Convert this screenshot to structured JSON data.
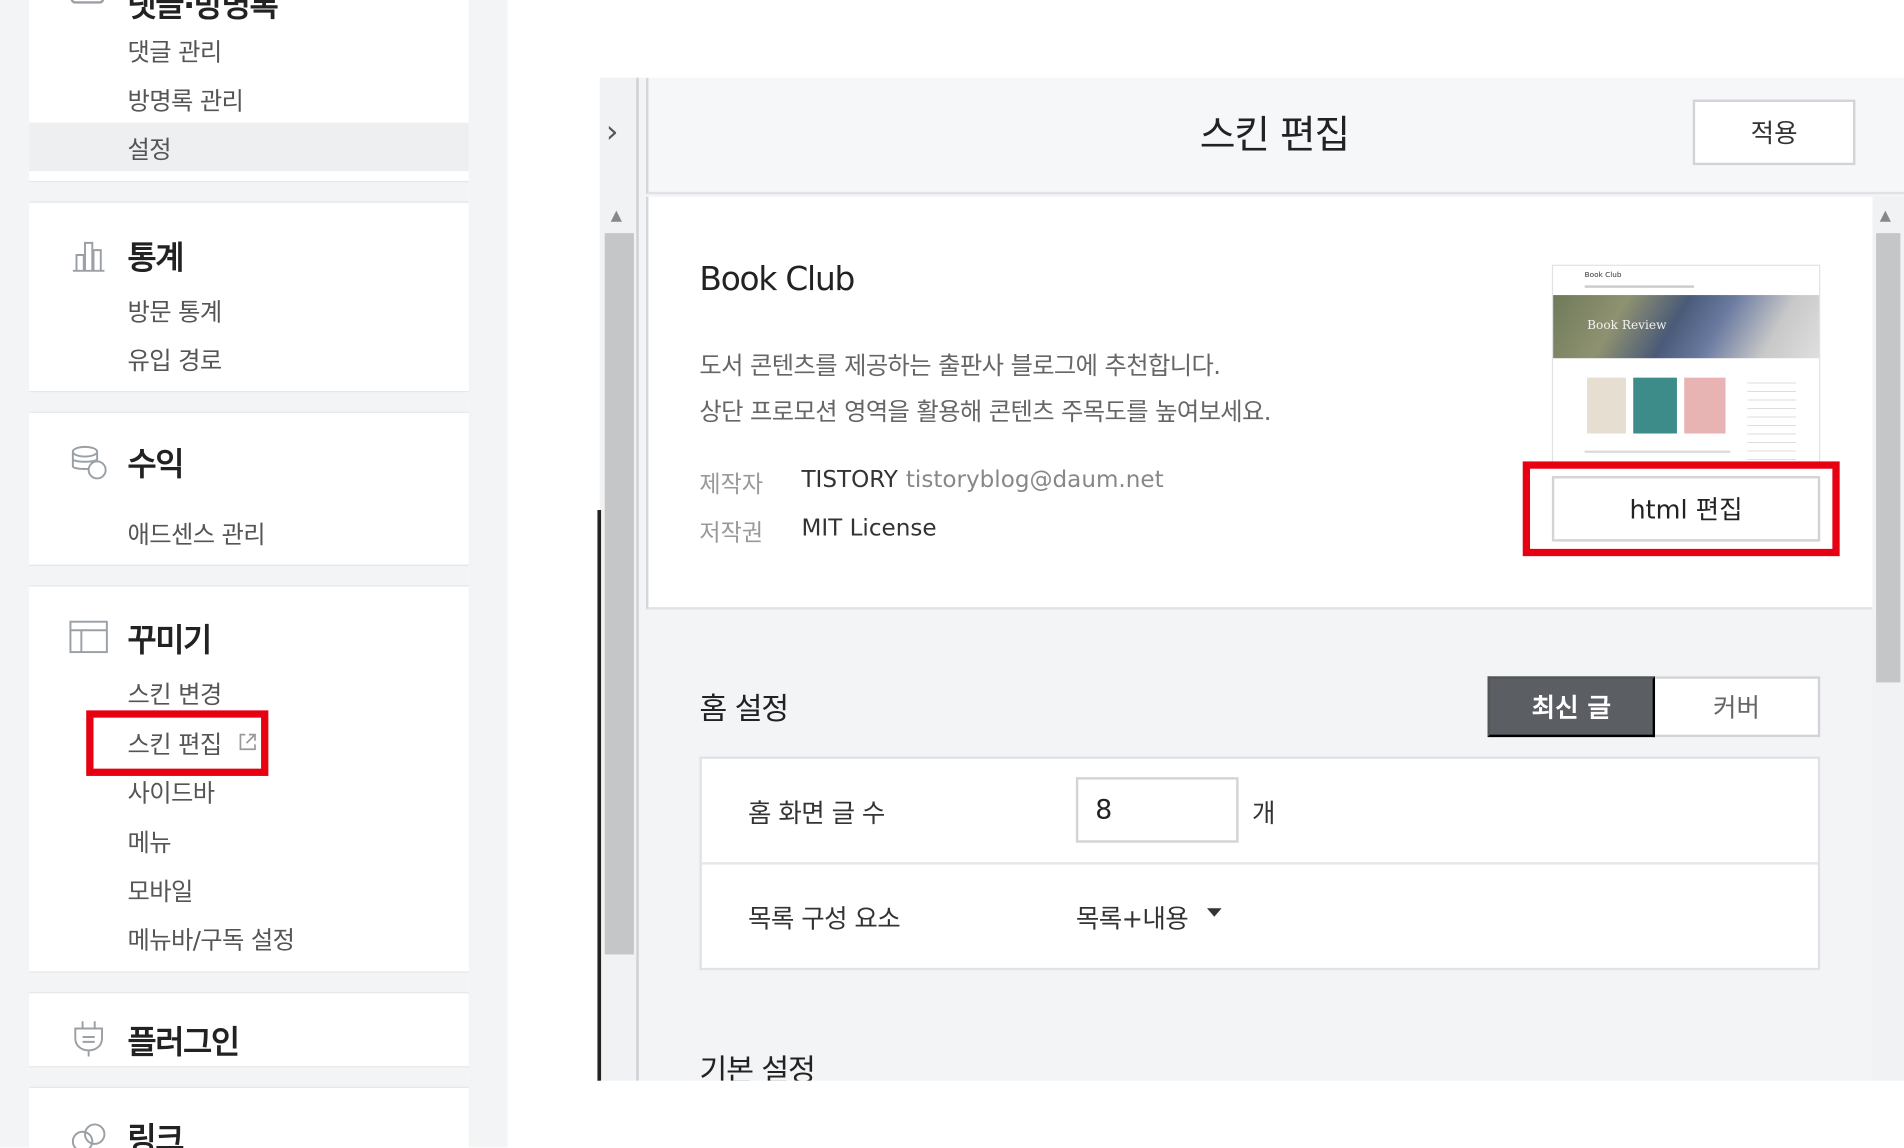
{
  "sidebar": {
    "top_partial_title": "댓글·방명록",
    "comments_items": [
      "댓글 관리",
      "방명록 관리",
      "설정"
    ],
    "stats": {
      "title": "통계",
      "items": [
        "방문 통계",
        "유입 경로"
      ]
    },
    "revenue": {
      "title": "수익",
      "items": [
        "애드센스 관리"
      ]
    },
    "decorate": {
      "title": "꾸미기",
      "items": [
        "스킨 변경",
        "스킨 편집",
        "사이드바",
        "메뉴",
        "모바일",
        "메뉴바/구독 설정"
      ]
    },
    "plugin": {
      "title": "플러그인"
    },
    "link": {
      "title": "링크"
    }
  },
  "editor": {
    "title": "스킨 편집",
    "apply_label": "적용",
    "skin": {
      "name": "Book Club",
      "desc_line1": "도서 콘텐츠를 제공하는 출판사 블로그에 추천합니다.",
      "desc_line2": "상단 프로모션 영역을 활용해 콘텐츠 주목도를 높여보세요.",
      "maker_label": "제작자",
      "maker_value": "TISTORY",
      "maker_email": "tistoryblog@daum.net",
      "license_label": "저작권",
      "license_value": "MIT License",
      "html_edit_label": "html 편집",
      "thumb_title": "Book Club",
      "thumb_banner": "Book Review"
    },
    "home": {
      "title": "홈 설정",
      "toggle_active": "최신 글",
      "toggle_inactive": "커버",
      "posts_label": "홈 화면 글 수",
      "posts_value": "8",
      "posts_unit": "개",
      "list_label": "목록 구성 요소",
      "list_value": "목록+내용"
    },
    "basic_title": "기본 설정"
  },
  "colors": {
    "highlight": "#e60012",
    "toggle_active_bg": "#5b5e62"
  }
}
